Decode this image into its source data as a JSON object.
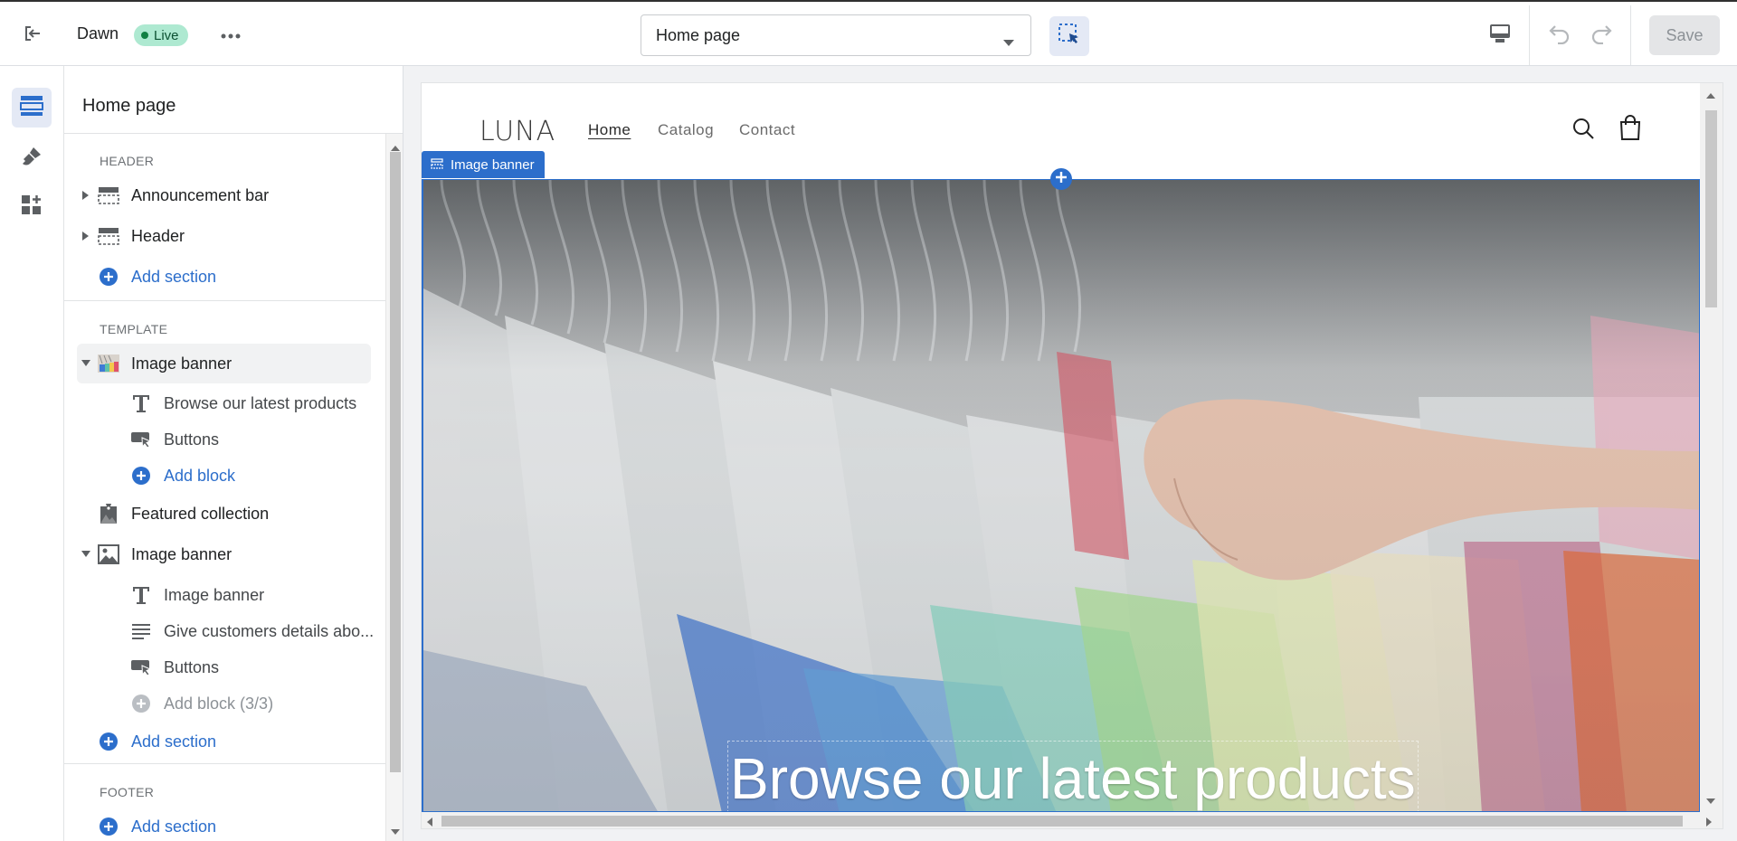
{
  "topbar": {
    "theme_name": "Dawn",
    "status_badge": "Live",
    "page_selector_value": "Home page",
    "save_label": "Save"
  },
  "sidebar": {
    "title": "Home page",
    "header_group_label": "HEADER",
    "header_items": [
      {
        "label": "Announcement bar"
      },
      {
        "label": "Header"
      }
    ],
    "header_add_section": "Add section",
    "template_group_label": "TEMPLATE",
    "template_items": {
      "banner1": "Image banner",
      "banner1_blocks": [
        "Browse our latest products",
        "Buttons"
      ],
      "banner1_add_block": "Add block",
      "featured": "Featured collection",
      "banner2": "Image banner",
      "banner2_blocks": [
        "Image banner",
        "Give customers details abo...",
        "Buttons"
      ],
      "banner2_add_block": "Add block (3/3)"
    },
    "template_add_section": "Add section",
    "footer_group_label": "FOOTER",
    "footer_add_section": "Add section"
  },
  "preview": {
    "logo": "LUNA",
    "nav": [
      "Home",
      "Catalog",
      "Contact"
    ],
    "section_tag": "Image banner",
    "banner_heading": "Browse our latest products"
  },
  "colors": {
    "accent": "#2c6ecb",
    "live_badge_bg": "#aee9d1",
    "live_dot": "#108043"
  }
}
